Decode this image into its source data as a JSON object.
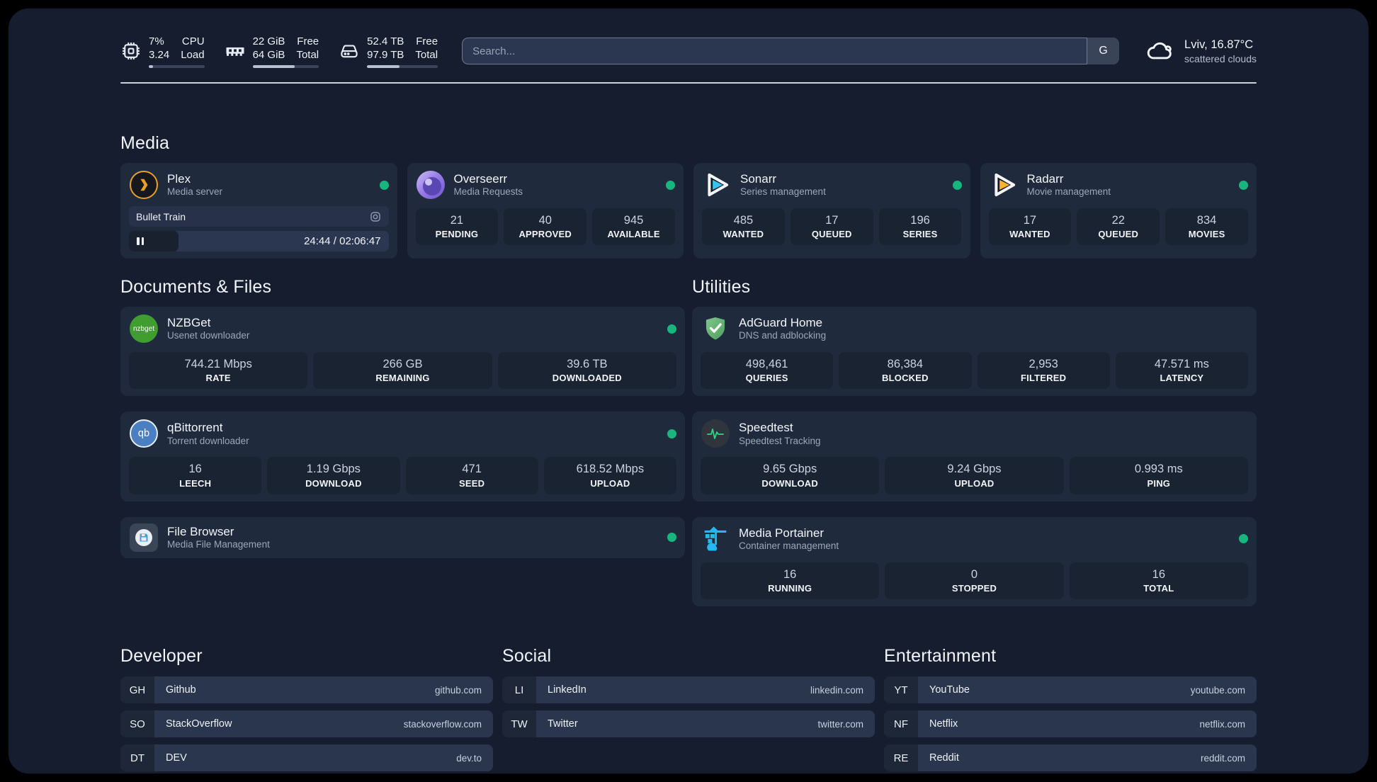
{
  "colors": {
    "accent_green": "#17b67f",
    "panel_bg": "#151d2f",
    "card_bg": "#202a3d"
  },
  "header": {
    "stats": [
      {
        "icon": "cpu-icon",
        "value_top": "7%",
        "value_bottom": "3.24",
        "label_top": "CPU",
        "label_bottom": "Load",
        "progress": 7
      },
      {
        "icon": "memory-icon",
        "value_top": "22 GiB",
        "value_bottom": "64 GiB",
        "label_top": "Free",
        "label_bottom": "Total",
        "progress": 63
      },
      {
        "icon": "disk-icon",
        "value_top": "52.4 TB",
        "value_bottom": "97.9 TB",
        "label_top": "Free",
        "label_bottom": "Total",
        "progress": 46
      }
    ],
    "search": {
      "placeholder": "Search...",
      "engine_label": "G"
    },
    "weather": {
      "location_temp": "Lviv, 16.87°C",
      "condition": "scattered clouds"
    }
  },
  "media": {
    "heading": "Media",
    "plex": {
      "title": "Plex",
      "subtitle": "Media server",
      "online": true,
      "now_playing": {
        "title": "Bullet Train",
        "time": "24:44 / 02:06:47",
        "progress": 19
      }
    },
    "overseerr": {
      "title": "Overseerr",
      "subtitle": "Media Requests",
      "online": true,
      "stats": [
        {
          "value": "21",
          "label": "PENDING"
        },
        {
          "value": "40",
          "label": "APPROVED"
        },
        {
          "value": "945",
          "label": "AVAILABLE"
        }
      ]
    },
    "sonarr": {
      "title": "Sonarr",
      "subtitle": "Series management",
      "online": true,
      "stats": [
        {
          "value": "485",
          "label": "WANTED"
        },
        {
          "value": "17",
          "label": "QUEUED"
        },
        {
          "value": "196",
          "label": "SERIES"
        }
      ]
    },
    "radarr": {
      "title": "Radarr",
      "subtitle": "Movie management",
      "online": true,
      "stats": [
        {
          "value": "17",
          "label": "WANTED"
        },
        {
          "value": "22",
          "label": "QUEUED"
        },
        {
          "value": "834",
          "label": "MOVIES"
        }
      ]
    }
  },
  "documents": {
    "heading": "Documents & Files",
    "nzbget": {
      "title": "NZBGet",
      "subtitle": "Usenet downloader",
      "online": true,
      "stats": [
        {
          "value": "744.21 Mbps",
          "label": "RATE"
        },
        {
          "value": "266 GB",
          "label": "REMAINING"
        },
        {
          "value": "39.6 TB",
          "label": "DOWNLOADED"
        }
      ]
    },
    "qbittorrent": {
      "title": "qBittorrent",
      "subtitle": "Torrent downloader",
      "online": true,
      "stats": [
        {
          "value": "16",
          "label": "LEECH"
        },
        {
          "value": "1.19 Gbps",
          "label": "DOWNLOAD"
        },
        {
          "value": "471",
          "label": "SEED"
        },
        {
          "value": "618.52 Mbps",
          "label": "UPLOAD"
        }
      ]
    },
    "filebrowser": {
      "title": "File Browser",
      "subtitle": "Media File Management",
      "online": true
    }
  },
  "utilities": {
    "heading": "Utilities",
    "adguard": {
      "title": "AdGuard Home",
      "subtitle": "DNS and adblocking",
      "stats": [
        {
          "value": "498,461",
          "label": "QUERIES"
        },
        {
          "value": "86,384",
          "label": "BLOCKED"
        },
        {
          "value": "2,953",
          "label": "FILTERED"
        },
        {
          "value": "47.571 ms",
          "label": "LATENCY"
        }
      ]
    },
    "speedtest": {
      "title": "Speedtest",
      "subtitle": "Speedtest Tracking",
      "stats": [
        {
          "value": "9.65 Gbps",
          "label": "DOWNLOAD"
        },
        {
          "value": "9.24 Gbps",
          "label": "UPLOAD"
        },
        {
          "value": "0.993 ms",
          "label": "PING"
        }
      ]
    },
    "portainer": {
      "title": "Media Portainer",
      "subtitle": "Container management",
      "online": true,
      "stats": [
        {
          "value": "16",
          "label": "RUNNING"
        },
        {
          "value": "0",
          "label": "STOPPED"
        },
        {
          "value": "16",
          "label": "TOTAL"
        }
      ]
    }
  },
  "bookmarks": [
    {
      "heading": "Developer",
      "links": [
        {
          "abbr": "GH",
          "name": "Github",
          "url": "github.com"
        },
        {
          "abbr": "SO",
          "name": "StackOverflow",
          "url": "stackoverflow.com"
        },
        {
          "abbr": "DT",
          "name": "DEV",
          "url": "dev.to"
        }
      ]
    },
    {
      "heading": "Social",
      "links": [
        {
          "abbr": "LI",
          "name": "LinkedIn",
          "url": "linkedin.com"
        },
        {
          "abbr": "TW",
          "name": "Twitter",
          "url": "twitter.com"
        }
      ]
    },
    {
      "heading": "Entertainment",
      "links": [
        {
          "abbr": "YT",
          "name": "YouTube",
          "url": "youtube.com"
        },
        {
          "abbr": "NF",
          "name": "Netflix",
          "url": "netflix.com"
        },
        {
          "abbr": "RE",
          "name": "Reddit",
          "url": "reddit.com"
        }
      ]
    }
  ],
  "icons": {
    "nzbget_logo_text": "nzbget",
    "qbittorrent_logo_text": "qb"
  }
}
